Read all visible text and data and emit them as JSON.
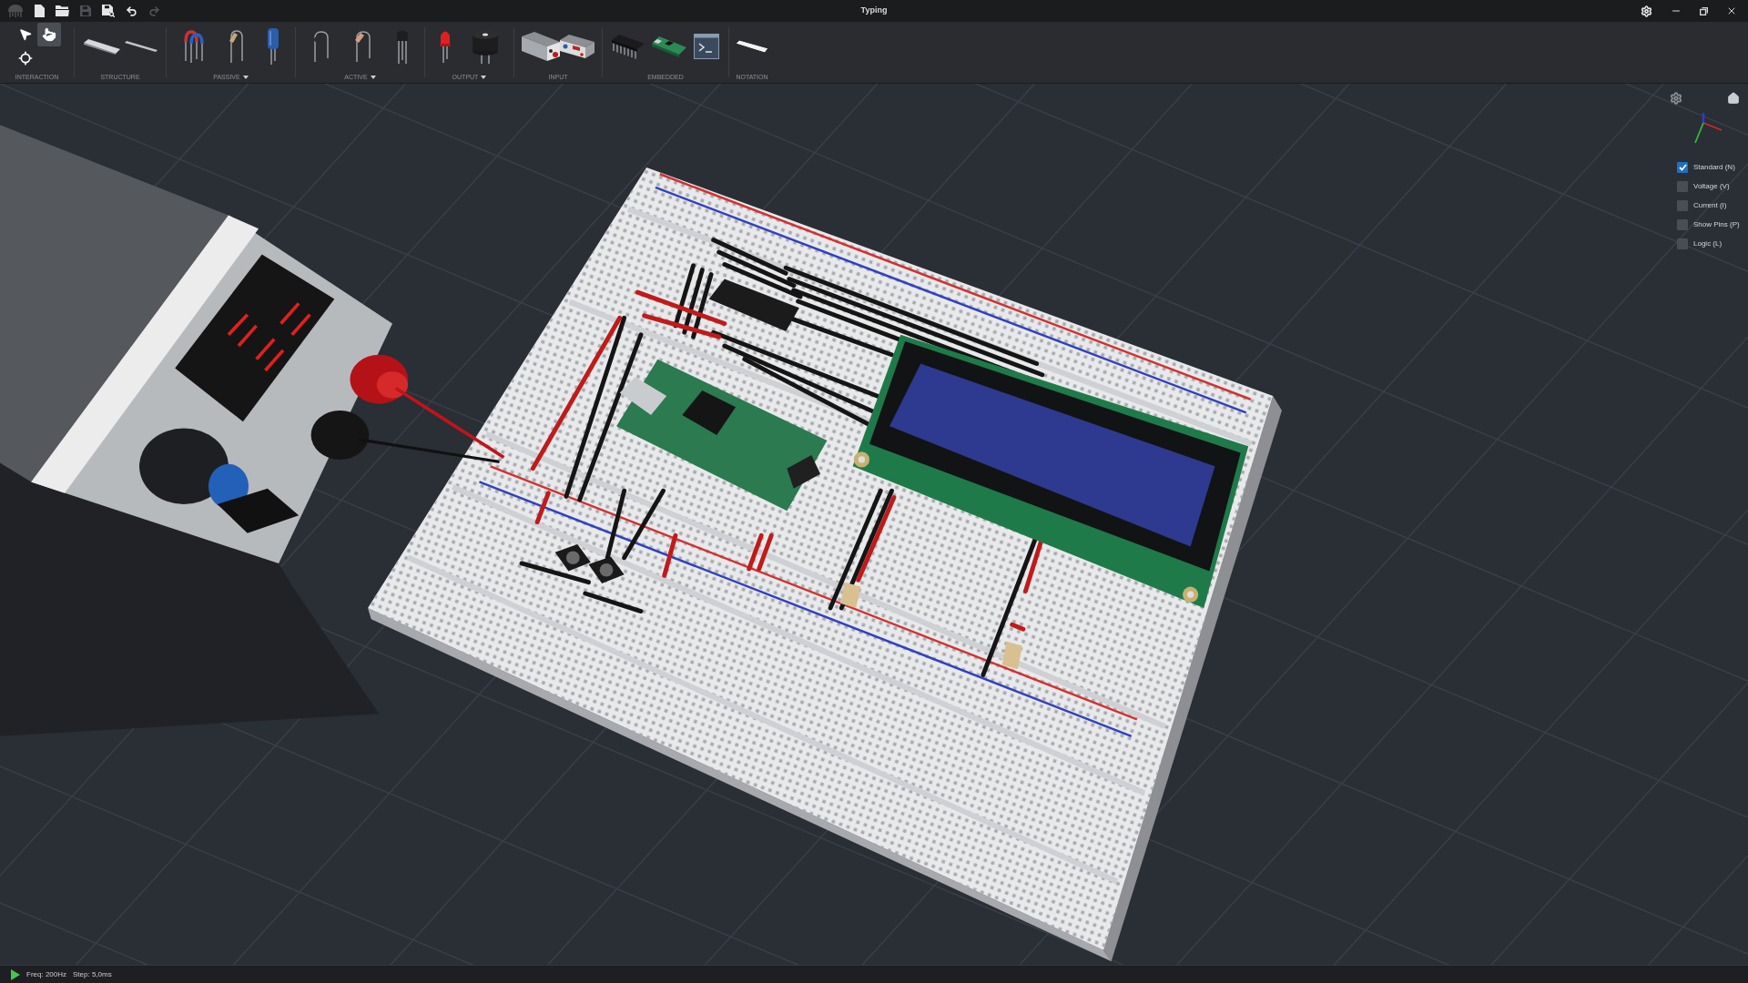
{
  "title_bar": {
    "actions": [
      {
        "kind": "new",
        "disabled": false
      },
      {
        "kind": "open",
        "disabled": false
      },
      {
        "kind": "save",
        "disabled": true
      },
      {
        "kind": "save_as",
        "disabled": false
      },
      {
        "kind": "undo",
        "disabled": false
      },
      {
        "kind": "redo",
        "disabled": true
      }
    ],
    "title": "Typing",
    "controls": [
      {
        "kind": "settings"
      },
      {
        "kind": "minimize"
      },
      {
        "kind": "restore"
      },
      {
        "kind": "close"
      }
    ]
  },
  "toolbar": {
    "groups": [
      {
        "label": "INTERACTION",
        "dropdown": false,
        "items": [
          {
            "kind": "pointer",
            "selected": false
          },
          {
            "kind": "hand",
            "selected": true
          },
          {
            "kind": "orbit",
            "selected": false
          }
        ]
      },
      {
        "label": "STRUCTURE",
        "dropdown": false,
        "items": [
          {
            "kind": "breadboard"
          },
          {
            "kind": "rail"
          }
        ]
      },
      {
        "label": "PASSIVE",
        "dropdown": true,
        "items": [
          {
            "kind": "jumper"
          },
          {
            "kind": "resistor"
          },
          {
            "kind": "capacitor"
          }
        ]
      },
      {
        "label": "ACTIVE",
        "dropdown": true,
        "items": [
          {
            "kind": "diode"
          },
          {
            "kind": "glass_diode"
          },
          {
            "kind": "transistor"
          }
        ]
      },
      {
        "label": "OUTPUT",
        "dropdown": true,
        "items": [
          {
            "kind": "led"
          },
          {
            "kind": "buzzer"
          }
        ]
      },
      {
        "label": "INPUT",
        "dropdown": false,
        "items": [
          {
            "kind": "power_supply"
          },
          {
            "kind": "bench_supply"
          }
        ]
      },
      {
        "label": "EMBEDDED",
        "dropdown": false,
        "items": [
          {
            "kind": "ic_chip"
          },
          {
            "kind": "microcontroller"
          },
          {
            "kind": "terminal"
          }
        ]
      },
      {
        "label": "NOTATION",
        "dropdown": false,
        "items": [
          {
            "kind": "label_tag"
          }
        ]
      }
    ]
  },
  "viewport": {
    "tools": [
      {
        "kind": "settings"
      },
      {
        "kind": "home"
      }
    ],
    "view_modes": [
      {
        "label": "Standard (N)",
        "checked": true
      },
      {
        "label": "Voltage (V)",
        "checked": false
      },
      {
        "label": "Current (I)",
        "checked": false
      },
      {
        "label": "Show Pins (P)",
        "checked": false
      },
      {
        "label": "Logic (L)",
        "checked": false
      }
    ]
  },
  "status_bar": {
    "frequency": "Freq: 200Hz",
    "step": "Step: 5,0ms"
  }
}
